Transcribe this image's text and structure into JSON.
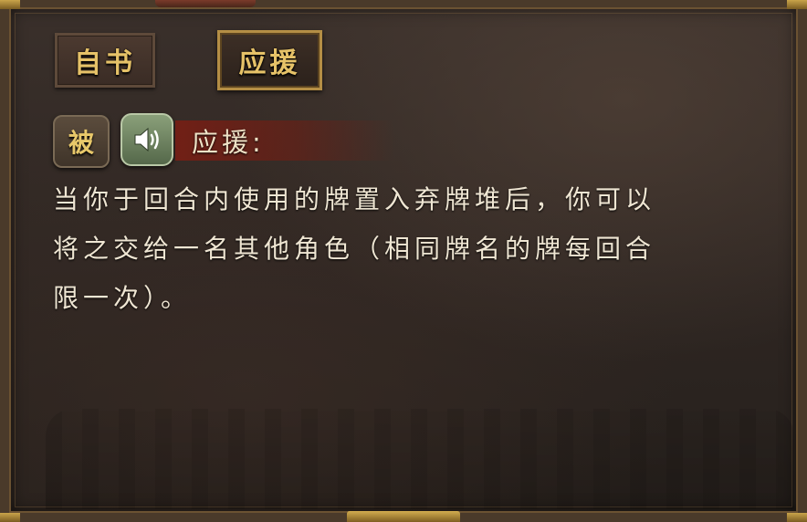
{
  "tabs": [
    {
      "label": "自书",
      "active": false
    },
    {
      "label": "应援",
      "active": true
    }
  ],
  "skill": {
    "type_badge": "被",
    "audio_icon": "speaker-icon",
    "name": "应援:",
    "description_lines": [
      "当你于回合内使用的牌置入弃牌堆后，你可以",
      "将之交给一名其他角色（相同牌名的牌每回合",
      "限一次）。"
    ]
  },
  "colors": {
    "gold_text": "#e6c268",
    "panel_bg": "#2e2622",
    "name_bar": "#78201a",
    "body_text": "#efe6d3"
  }
}
